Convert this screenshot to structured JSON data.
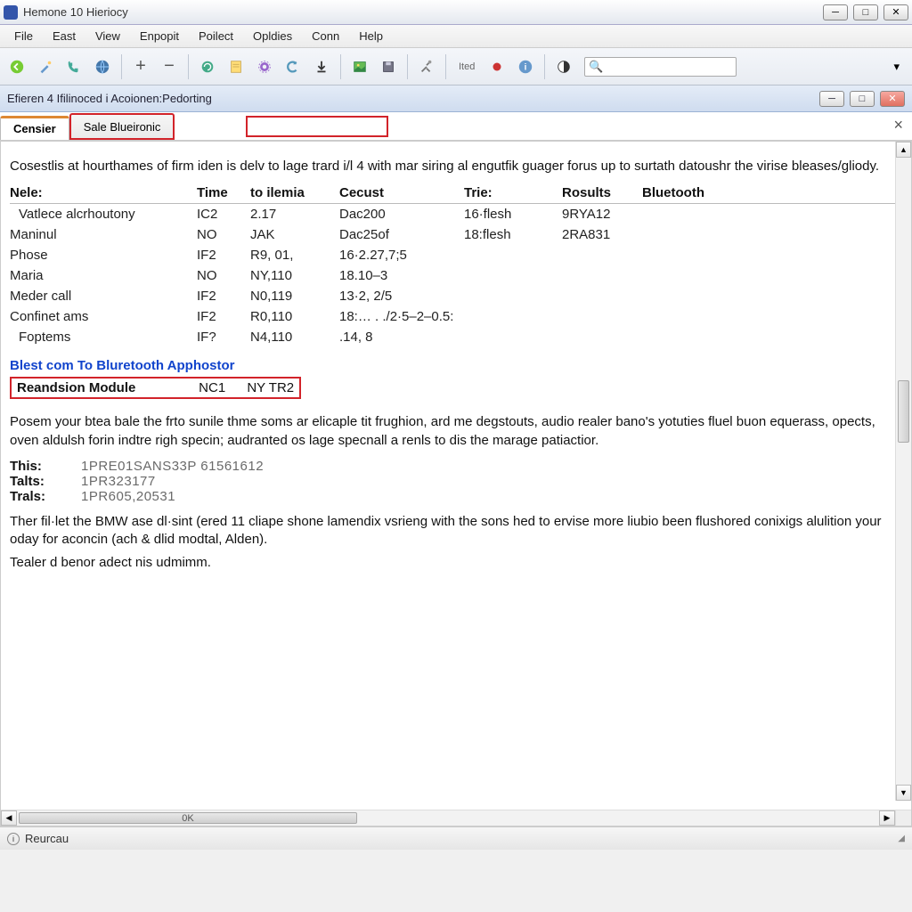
{
  "window": {
    "title": "Hemone 10 Hieriocy",
    "buttons": {
      "min": "─",
      "max": "□",
      "close": "✕"
    }
  },
  "menu": {
    "file": "File",
    "east": "East",
    "view": "View",
    "enpopit": "Enpopit",
    "poilect": "Poilect",
    "opldies": "Opldies",
    "conn": "Conn",
    "help": "Help"
  },
  "toolbar": {
    "search_placeholder": "",
    "ited_label": "Ited"
  },
  "subwin": {
    "title": "Efieren 4 Ifilinoced i Acoionen:Pedorting",
    "buttons": {
      "min": "─",
      "max": "□",
      "close": "✕"
    }
  },
  "tabs": {
    "censier": "Censier",
    "sale": "Sale Blueironic"
  },
  "intro": "Cosestlis at hourthames of firm iden is delv to lage trard i/l 4 with mar siring al engutfik guager forus up to surtath datoushr the virise bleases/gliody.",
  "table": {
    "headers": {
      "nele": "Nele:",
      "time": "Time",
      "ilemia": "to ilemia",
      "cecust": "Cecust",
      "trie": "Trie:",
      "rosults": "Rosults",
      "bluetooth": "Bluetooth"
    },
    "rows": [
      {
        "nele": "Vatlece alcrhoutony",
        "time": "IC2",
        "ilemia": "2.17",
        "cecust": "Dac200",
        "trie": "16·flesh",
        "rosults": "9RYA12",
        "bluetooth": ""
      },
      {
        "nele": "Maninul",
        "time": "NO",
        "ilemia": "JAK",
        "cecust": "Dac25of",
        "trie": "18:flesh",
        "rosults": "2RA831",
        "bluetooth": ""
      },
      {
        "nele": "Phose",
        "time": "IF2",
        "ilemia": "R9, 01,",
        "cecust": "16·2.27,7;5",
        "trie": "",
        "rosults": "",
        "bluetooth": ""
      },
      {
        "nele": "Maria",
        "time": "NO",
        "ilemia": "NY,110",
        "cecust": "18.10–3",
        "trie": "",
        "rosults": "",
        "bluetooth": ""
      },
      {
        "nele": "Meder call",
        "time": "IF2",
        "ilemia": "N0,119",
        "cecust": "13·2,  2/5",
        "trie": "",
        "rosults": "",
        "bluetooth": ""
      },
      {
        "nele": "Confinet ams",
        "time": "IF2",
        "ilemia": "R0,110",
        "cecust": "18:… . ./2·5–2–0.5:",
        "trie": "",
        "rosults": "",
        "bluetooth": ""
      },
      {
        "nele": "Foptems",
        "time": "IF?",
        "ilemia": "N4,110",
        "cecust": ".14, 8",
        "trie": "",
        "rosults": "",
        "bluetooth": ""
      }
    ]
  },
  "section": {
    "link": "Blest com To Bluretooth Apphostor",
    "module": {
      "label": "Reandsion Module",
      "c1": "NC1",
      "c2": "NY TR2"
    }
  },
  "para2": "Posem your btea bale the frto sunile thme soms ar elicaple tit frughion, ard me degstouts, audio realer bano's yotuties fluel buon equerass, opects, oven aldulsh forin indtre righ specin; audranted os lage specnall a renls to dis the marage patiactior.",
  "kv": {
    "this": {
      "k": "This:",
      "v": "1PRE01SANS33P 61561612"
    },
    "talts": {
      "k": "Talts:",
      "v": "1PR323177"
    },
    "trals": {
      "k": "Trals:",
      "v": "1PR605,20531"
    }
  },
  "para3": "Ther fil·let the BMW ase dl·sint (ered 11 cliape shone lamendix vsrieng with the sons hed to ervise more liubio been flushored conixigs alulition your oday for aconcin (ach & dlid modtal, Alden).",
  "para4": "Tealer d benor adect nis udmimm.",
  "hscroll_label": "0K",
  "status": {
    "text": "Reurcau"
  }
}
